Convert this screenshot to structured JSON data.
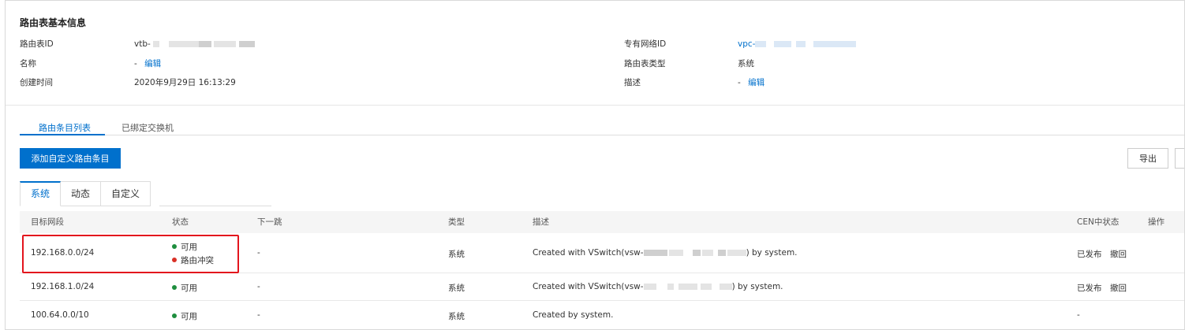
{
  "basic_info": {
    "title": "路由表基本信息",
    "route_table_id_label": "路由表ID",
    "route_table_id_value": "vtb-",
    "name_label": "名称",
    "name_value": "-",
    "edit_label": "编辑",
    "created_label": "创建时间",
    "created_value": "2020年9月29日 16:13:29",
    "vpc_id_label": "专有网络ID",
    "vpc_id_value": "vpc-",
    "type_label": "路由表类型",
    "type_value": "系统",
    "desc_label": "描述",
    "desc_value": "-"
  },
  "tabs": {
    "route_entries": "路由条目列表",
    "bound_vswitches": "已绑定交换机"
  },
  "toolbar": {
    "add_custom_route": "添加自定义路由条目",
    "export": "导出"
  },
  "segment_tabs": [
    "系统",
    "动态",
    "自定义"
  ],
  "table": {
    "headers": {
      "dest": "目标网段",
      "status": "状态",
      "next_hop": "下一跳",
      "type": "类型",
      "desc": "描述",
      "cen_status": "CEN中状态",
      "actions": "操作"
    },
    "rows": [
      {
        "dest": "192.168.0.0/24",
        "status_1": "可用",
        "status_2": "路由冲突",
        "next_hop": "-",
        "type": "系统",
        "desc_prefix": "Created with VSwitch(vsw-",
        "desc_suffix": ") by system.",
        "cen_status": "已发布",
        "action": "撤回"
      },
      {
        "dest": "192.168.1.0/24",
        "status_1": "可用",
        "next_hop": "-",
        "type": "系统",
        "desc_prefix": "Created with VSwitch(vsw-",
        "desc_suffix": ") by system.",
        "cen_status": "已发布",
        "action": "撤回"
      },
      {
        "dest": "100.64.0.0/10",
        "status_1": "可用",
        "next_hop": "-",
        "type": "系统",
        "desc": "Created by system.",
        "cen_status": "-"
      }
    ]
  },
  "colors": {
    "accent": "#0070cc",
    "available": "#1e8e3e",
    "conflict": "#d93026",
    "highlight": "#e3151d"
  }
}
